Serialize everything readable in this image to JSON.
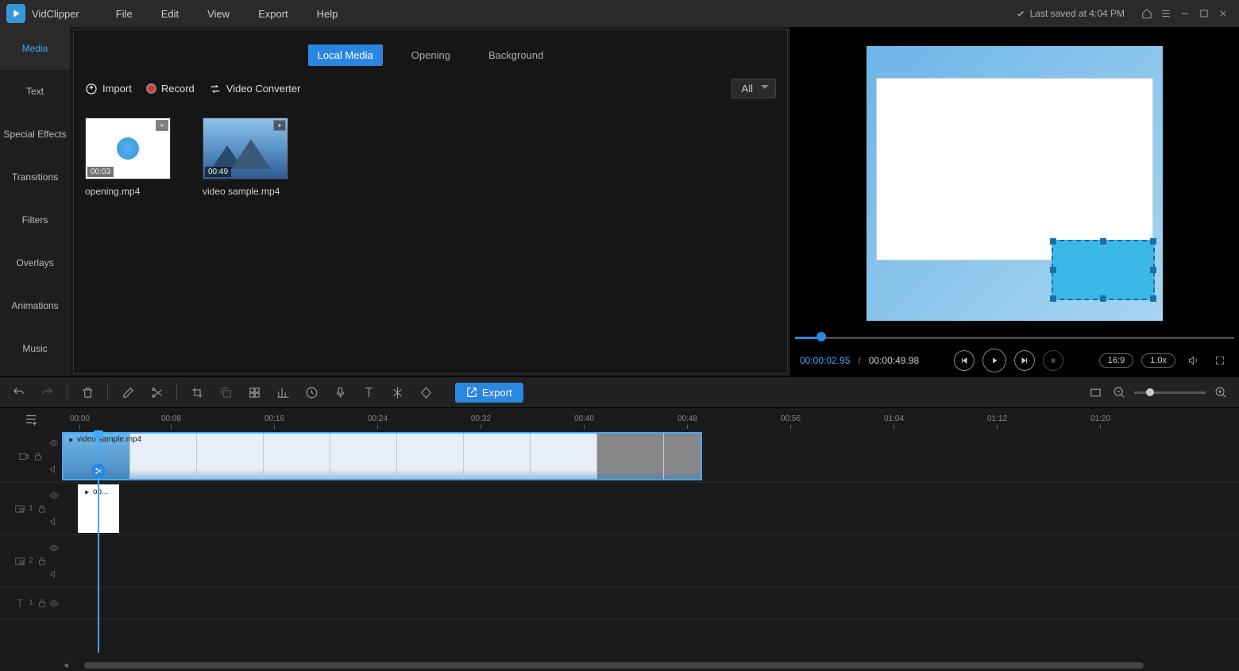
{
  "app": {
    "name": "VidClipper"
  },
  "menu": [
    "File",
    "Edit",
    "View",
    "Export",
    "Help"
  ],
  "save_status": "Last saved at 4:04 PM",
  "left_tabs": [
    "Media",
    "Text",
    "Special Effects",
    "Transitions",
    "Filters",
    "Overlays",
    "Animations",
    "Music"
  ],
  "media": {
    "tabs": [
      "Local Media",
      "Opening",
      "Background"
    ],
    "toolbar": {
      "import": "Import",
      "record": "Record",
      "converter": "Video Converter"
    },
    "filter": "All",
    "clips": [
      {
        "name": "opening.mp4",
        "dur": "00:03",
        "kind": "opening"
      },
      {
        "name": "video sample.mp4",
        "dur": "00:49",
        "kind": "mountain"
      }
    ]
  },
  "preview": {
    "time_current": "00:00:02.95",
    "time_total": "00:00:49.98",
    "aspect": "16:9",
    "speed": "1.0x"
  },
  "toolbar": {
    "export": "Export"
  },
  "timeline": {
    "ticks": [
      "00:00",
      "00:08",
      "00:16",
      "00:24",
      "00:32",
      "00:40",
      "00:48",
      "00:56",
      "01:04",
      "01:12",
      "01:20"
    ],
    "tracks": [
      {
        "id": "v1",
        "clip_name": "video sample.mp4"
      },
      {
        "id": "pip1",
        "num": "1",
        "clip_name": "op..."
      },
      {
        "id": "pip2",
        "num": "2"
      },
      {
        "id": "t1",
        "num": "1"
      }
    ]
  }
}
